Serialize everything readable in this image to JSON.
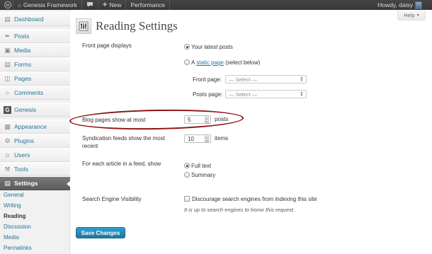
{
  "admin_bar": {
    "site_name": "Genesis Framework",
    "new_label": "New",
    "performance_label": "Performance",
    "howdy": "Howdy, daisy"
  },
  "sidebar": {
    "items": [
      {
        "label": "Dashboard",
        "icon": "dashboard-icon"
      },
      {
        "label": "Posts",
        "icon": "pushpin-icon"
      },
      {
        "label": "Media",
        "icon": "media-icon"
      },
      {
        "label": "Forms",
        "icon": "forms-icon"
      },
      {
        "label": "Pages",
        "icon": "pages-icon"
      },
      {
        "label": "Comments",
        "icon": "comments-icon"
      },
      {
        "label": "Genesis",
        "icon": "genesis-icon"
      },
      {
        "label": "Appearance",
        "icon": "appearance-icon"
      },
      {
        "label": "Plugins",
        "icon": "plugins-icon"
      },
      {
        "label": "Users",
        "icon": "users-icon"
      },
      {
        "label": "Tools",
        "icon": "tools-icon"
      },
      {
        "label": "Settings",
        "icon": "settings-icon"
      }
    ],
    "submenu": [
      "General",
      "Writing",
      "Reading",
      "Discussion",
      "Media",
      "Permalinks"
    ]
  },
  "help_label": "Help",
  "page_title": "Reading Settings",
  "front_page": {
    "label": "Front page displays",
    "option_latest": "Your latest posts",
    "option_static_prefix": "A",
    "option_static_link": "static page",
    "option_static_suffix": "(select below)",
    "front_page_label": "Front page:",
    "posts_page_label": "Posts page:",
    "select_placeholder": "— Select —"
  },
  "blog_pages": {
    "label": "Blog pages show at most",
    "value": "5",
    "unit": "posts"
  },
  "syndication": {
    "label": "Syndication feeds show the most recent",
    "value": "10",
    "unit": "items"
  },
  "feed_article": {
    "label": "For each article in a feed, show",
    "option_full": "Full text",
    "option_summary": "Summary"
  },
  "search_visibility": {
    "label": "Search Engine Visibility",
    "checkbox_label": "Discourage search engines from indexing this site",
    "hint": "It is up to search engines to honor this request."
  },
  "save_label": "Save Changes"
}
